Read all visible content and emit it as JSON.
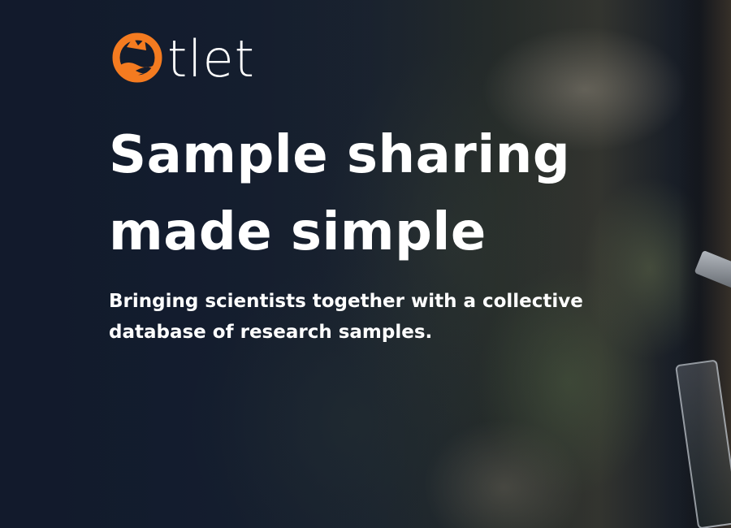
{
  "brand": {
    "name_suffix": "tlet",
    "logo_icon": "otlet-logo-icon",
    "accent_color": "#f47b20"
  },
  "hero": {
    "headline_line1": "Sample sharing",
    "headline_line2": "made simple",
    "subheadline": "Bringing scientists together with a collective database of research samples.",
    "background_image": "moss-covered-tree-bark-with-sample-vial-photo"
  }
}
